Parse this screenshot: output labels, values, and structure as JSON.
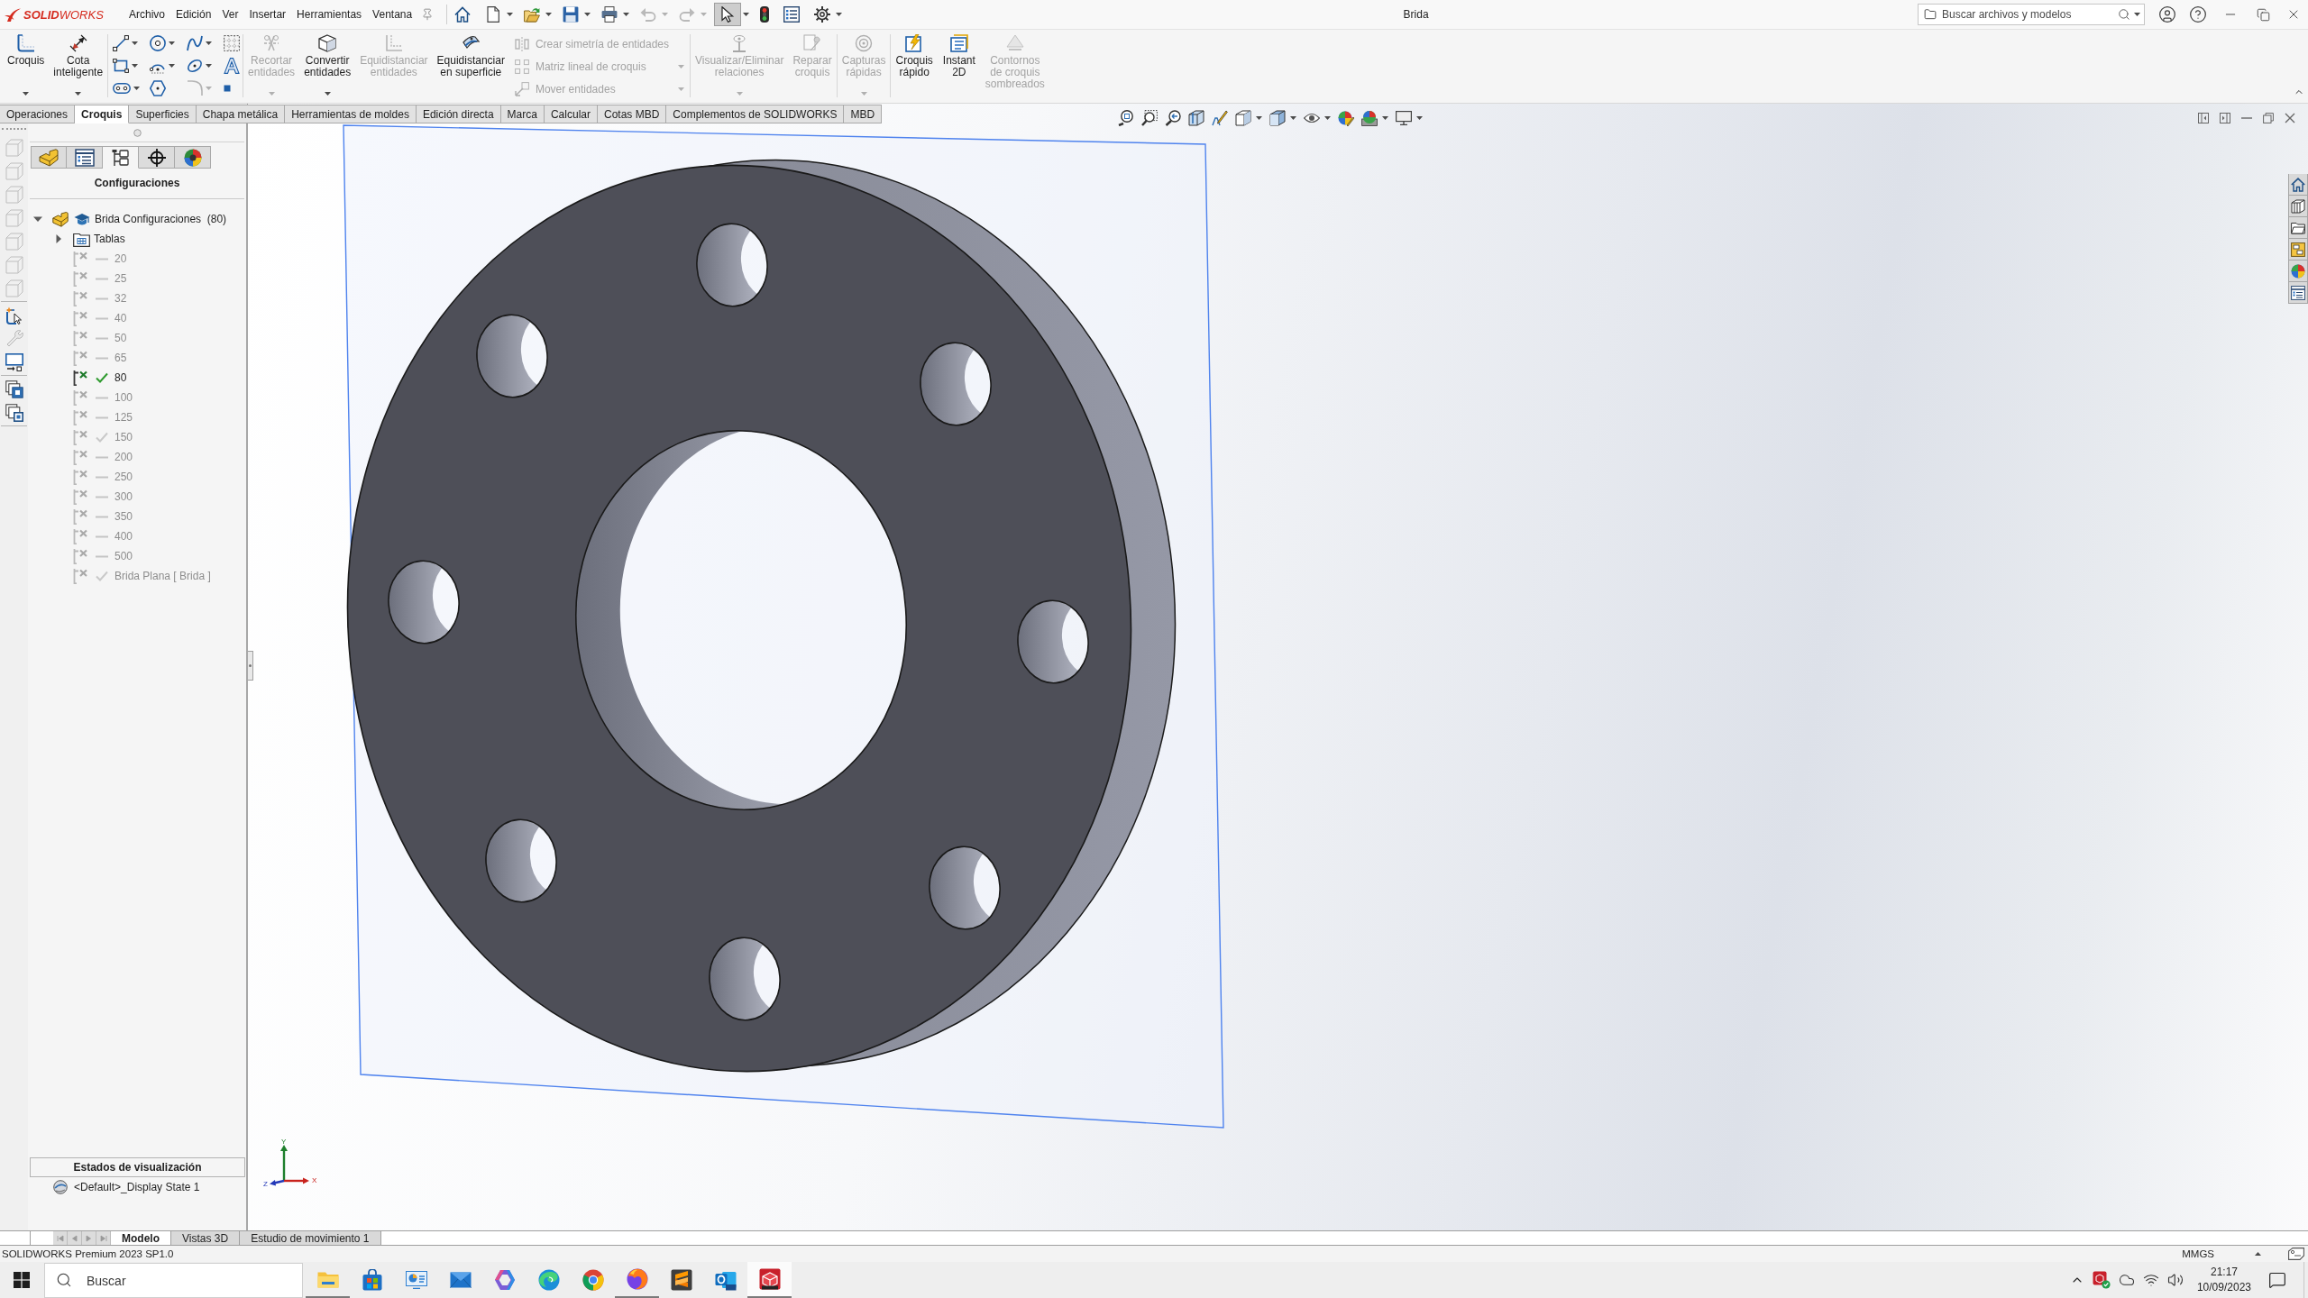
{
  "window": {
    "logo": "**SOLID**WORKS",
    "menu": [
      "Archivo",
      "Edición",
      "Ver",
      "Insertar",
      "Herramientas",
      "Ventana"
    ],
    "quick_access": [
      {
        "disabled": false,
        "pressed": false,
        "caret": false
      },
      {
        "disabled": false,
        "pressed": false,
        "caret": true
      },
      {
        "disabled": false,
        "pressed": false,
        "caret": true
      },
      {
        "disabled": false,
        "pressed": false,
        "caret": true
      },
      {
        "disabled": false,
        "pressed": false,
        "caret": true
      },
      {
        "disabled": true,
        "pressed": false,
        "caret": true
      },
      {
        "disabled": true,
        "pressed": false,
        "caret": true
      },
      {
        "disabled": false,
        "pressed": true,
        "caret": true
      },
      {
        "disabled": false,
        "pressed": false,
        "caret": false
      },
      {
        "disabled": false,
        "pressed": false,
        "caret": false
      },
      {
        "disabled": false,
        "pressed": false,
        "caret": true
      }
    ],
    "title": "Brida",
    "search": {
      "placeholder": "Buscar archivos y modelos"
    }
  },
  "ribbon": {
    "groups": [
      {
        "items": [
          {
            "kind": "large",
            "label": "Croquis",
            "disabled": false,
            "caret": true
          },
          {
            "kind": "large",
            "label": "Cota\ninteligente",
            "disabled": false,
            "caret": true
          }
        ]
      },
      {
        "items": [
          {
            "kind": "tools",
            "tools": [
              {
                "disabled": false,
                "caret": true
              },
              {
                "disabled": false,
                "caret": true
              },
              {
                "disabled": false,
                "caret": true
              },
              {
                "disabled": false,
                "caret": false
              },
              {
                "disabled": false,
                "caret": true
              },
              {
                "disabled": false,
                "caret": true
              },
              {
                "disabled": false,
                "caret": true
              },
              {
                "disabled": false,
                "caret": false
              },
              {
                "disabled": false,
                "caret": true
              },
              {
                "disabled": false,
                "caret": false
              },
              {
                "disabled": true,
                "caret": true
              },
              {
                "disabled": false,
                "caret": false
              }
            ]
          }
        ]
      },
      {
        "items": [
          {
            "kind": "large",
            "label": "Recortar\nentidades",
            "disabled": true,
            "caret": true
          },
          {
            "kind": "large",
            "label": "Convertir\nentidades",
            "disabled": false,
            "caret": true
          },
          {
            "kind": "large",
            "label": "Equidistanciar\nentidades",
            "disabled": true,
            "caret": false
          },
          {
            "kind": "large",
            "label": "Equidistanciar\nen superficie",
            "disabled": false,
            "caret": false
          },
          {
            "kind": "list",
            "entries": [
              {
                "label": "Crear simetría de entidades",
                "disabled": true,
                "caret": false
              },
              {
                "label": "Matriz lineal de croquis",
                "disabled": true,
                "caret": true
              },
              {
                "label": "Mover entidades",
                "disabled": true,
                "caret": true
              }
            ]
          }
        ]
      },
      {
        "items": [
          {
            "kind": "large",
            "label": "Visualizar/Eliminar\nrelaciones",
            "disabled": true,
            "caret": true
          },
          {
            "kind": "large",
            "label": "Reparar\ncroquis",
            "disabled": true,
            "caret": false
          }
        ]
      },
      {
        "items": [
          {
            "kind": "large",
            "label": "Capturas\nrápidas",
            "disabled": true,
            "caret": true
          }
        ]
      },
      {
        "items": [
          {
            "kind": "large",
            "label": "Croquis\nrápido",
            "disabled": false,
            "caret": false
          },
          {
            "kind": "large",
            "label": "Instant\n2D",
            "disabled": false,
            "caret": false
          },
          {
            "kind": "large",
            "label": "Contornos\nde croquis\nsombreados",
            "disabled": true,
            "caret": false
          }
        ]
      }
    ]
  },
  "tabs": [
    {
      "label": "Operaciones",
      "selected": false
    },
    {
      "label": "Croquis",
      "selected": true
    },
    {
      "label": "Superficies",
      "selected": false
    },
    {
      "label": "Chapa metálica",
      "selected": false
    },
    {
      "label": "Herramientas de moldes",
      "selected": false
    },
    {
      "label": "Edición directa",
      "selected": false
    },
    {
      "label": "Marca",
      "selected": false
    },
    {
      "label": "Calcular",
      "selected": false
    },
    {
      "label": "Cotas MBD",
      "selected": false
    },
    {
      "label": "Complementos de SOLIDWORKS",
      "selected": false
    },
    {
      "label": "MBD",
      "selected": false
    }
  ],
  "left_toolbar": {
    "groups": [
      {
        "items": [
          {
            "disabled": true
          },
          {
            "disabled": true
          },
          {
            "disabled": true
          },
          {
            "disabled": true
          },
          {
            "disabled": true
          },
          {
            "disabled": true
          },
          {
            "disabled": true
          }
        ]
      },
      {
        "items": [
          {
            "disabled": false
          },
          {
            "disabled": true
          },
          {
            "disabled": false
          }
        ]
      },
      {
        "items": [
          {
            "disabled": false
          },
          {
            "disabled": false
          }
        ]
      }
    ]
  },
  "feature_panel": {
    "tabs": [
      {
        "selected": false
      },
      {
        "selected": false
      },
      {
        "selected": true
      },
      {
        "selected": false
      },
      {
        "selected": false
      }
    ],
    "title": "Configuraciones",
    "tree": [
      {
        "kind": "part",
        "label": "Brida Configuraciones  (80)",
        "expanded": true,
        "children": [
          {
            "kind": "folder",
            "label": "Tablas",
            "expanded": false
          },
          {
            "kind": "config",
            "label": "20",
            "checked": false,
            "active": false
          },
          {
            "kind": "config",
            "label": "25",
            "checked": false,
            "active": false
          },
          {
            "kind": "config",
            "label": "32",
            "checked": false,
            "active": false
          },
          {
            "kind": "config",
            "label": "40",
            "checked": false,
            "active": false
          },
          {
            "kind": "config",
            "label": "50",
            "checked": false,
            "active": false
          },
          {
            "kind": "config",
            "label": "65",
            "checked": false,
            "active": false
          },
          {
            "kind": "config",
            "label": "80",
            "checked": true,
            "active": true
          },
          {
            "kind": "config",
            "label": "100",
            "checked": false,
            "active": false
          },
          {
            "kind": "config",
            "label": "125",
            "checked": false,
            "active": false
          },
          {
            "kind": "config",
            "label": "150",
            "checked": true,
            "active": false
          },
          {
            "kind": "config",
            "label": "200",
            "checked": false,
            "active": false
          },
          {
            "kind": "config",
            "label": "250",
            "checked": false,
            "active": false
          },
          {
            "kind": "config",
            "label": "300",
            "checked": false,
            "active": false
          },
          {
            "kind": "config",
            "label": "350",
            "checked": false,
            "active": false
          },
          {
            "kind": "config",
            "label": "400",
            "checked": false,
            "active": false
          },
          {
            "kind": "config",
            "label": "500",
            "checked": false,
            "active": false
          },
          {
            "kind": "config",
            "label": "Brida Plana [ Brida ]",
            "checked": true,
            "active": false
          }
        ]
      }
    ],
    "display_states": {
      "title": "Estados de visualización",
      "items": [
        {
          "label": "<Default>_Display State 1"
        }
      ]
    }
  },
  "viewport": {
    "axes": {
      "x": "X",
      "y": "Y",
      "z": "Z"
    }
  },
  "bottom_tabs": [
    {
      "label": "Modelo",
      "selected": true
    },
    {
      "label": "Vistas 3D",
      "selected": false
    },
    {
      "label": "Estudio de movimiento 1",
      "selected": false
    }
  ],
  "status_bar": {
    "product": "SOLIDWORKS Premium 2023 SP1.0",
    "units": "MMGS"
  },
  "taskbar": {
    "search": {
      "placeholder": "Buscar"
    },
    "apps": [
      {
        "running": true,
        "selected": false
      },
      {
        "running": false,
        "selected": false
      },
      {
        "running": false,
        "selected": false
      },
      {
        "running": false,
        "selected": false
      },
      {
        "running": false,
        "selected": false
      },
      {
        "running": false,
        "selected": false
      },
      {
        "running": false,
        "selected": false
      },
      {
        "running": true,
        "selected": false
      },
      {
        "running": false,
        "selected": false
      },
      {
        "running": false,
        "selected": false
      },
      {
        "running": true,
        "selected": true
      }
    ],
    "time": "21:17",
    "date": "10/09/2023"
  }
}
